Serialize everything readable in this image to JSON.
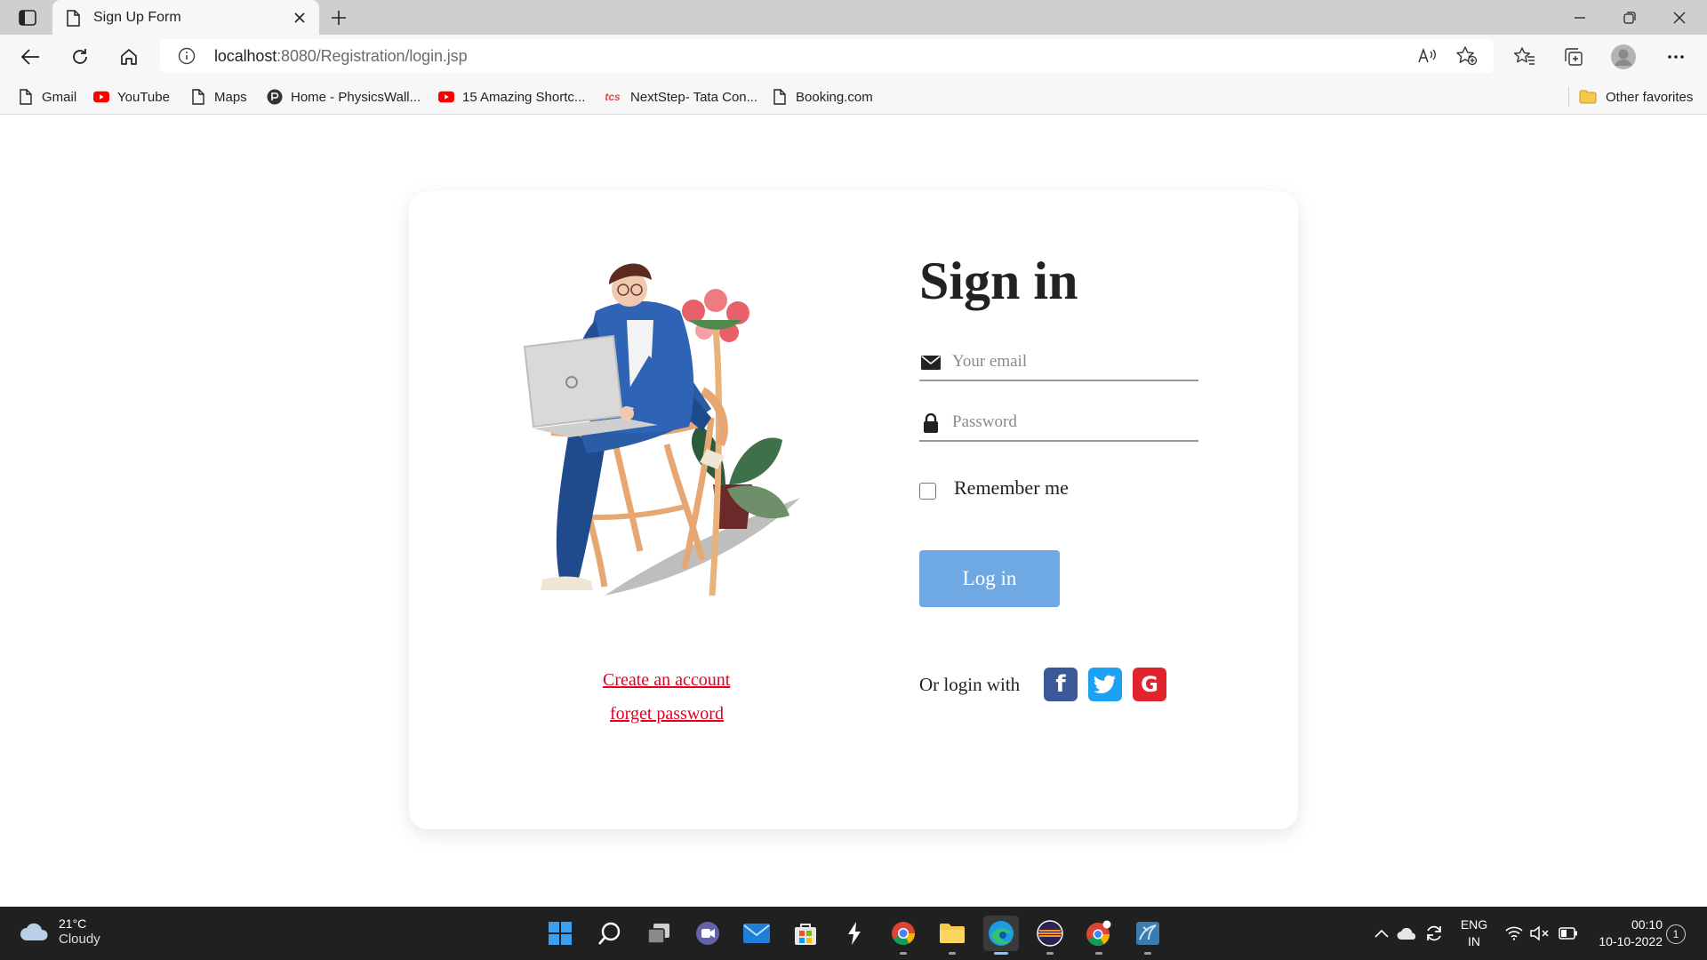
{
  "browser": {
    "tab_title": "Sign Up Form",
    "url_host": "localhost",
    "url_rest": ":8080/Registration/login.jsp"
  },
  "bookmarks": [
    {
      "label": "Gmail",
      "icon": "page-icon"
    },
    {
      "label": "YouTube",
      "icon": "youtube-icon"
    },
    {
      "label": "Maps",
      "icon": "page-icon"
    },
    {
      "label": "Home - PhysicsWall...",
      "icon": "physicswallah-icon"
    },
    {
      "label": "15 Amazing Shortc...",
      "icon": "youtube-icon"
    },
    {
      "label": "NextStep- Tata Con...",
      "icon": "tcs-icon"
    },
    {
      "label": "Booking.com",
      "icon": "page-icon"
    }
  ],
  "other_favorites": "Other favorites",
  "login": {
    "title": "Sign in",
    "email_placeholder": "Your email",
    "password_placeholder": "Password",
    "remember_label": "Remember me",
    "button_label": "Log in",
    "create_account": "Create an account",
    "forget_password": "forget password",
    "or_login_with": "Or login with",
    "social": [
      {
        "name": "facebook",
        "glyph": "f",
        "color": "#3b5998"
      },
      {
        "name": "twitter",
        "color": "#1da1f2"
      },
      {
        "name": "google",
        "glyph": "G",
        "color": "#e2232e"
      }
    ],
    "accent_color": "#6ea9e4",
    "link_color": "#e5001f"
  },
  "taskbar": {
    "weather_temp": "21°C",
    "weather_condition": "Cloudy",
    "apps": [
      "start",
      "search",
      "task-view",
      "teams-chat",
      "mail",
      "store",
      "sketch",
      "chrome",
      "file-explorer",
      "edge",
      "eclipse",
      "chrome-canary",
      "mysql-workbench"
    ],
    "lang_line1": "ENG",
    "lang_line2": "IN",
    "time": "00:10",
    "date": "10-10-2022",
    "notification_count": "1"
  }
}
